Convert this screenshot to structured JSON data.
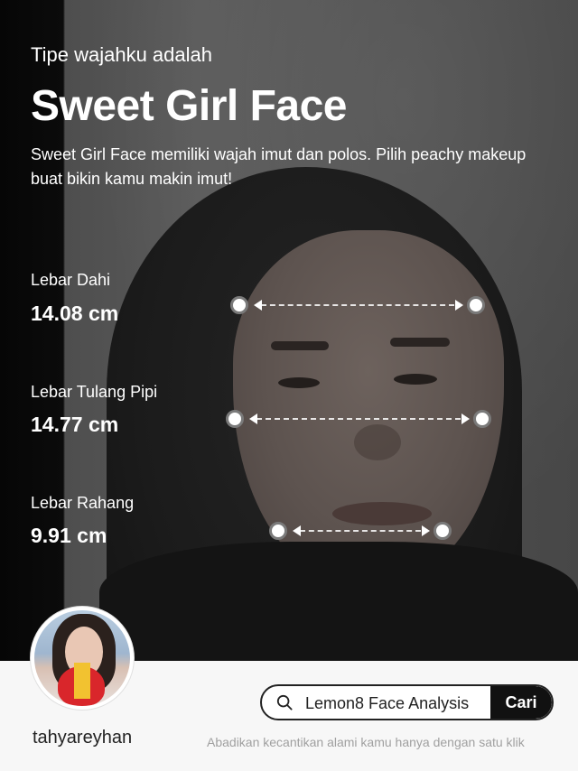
{
  "header": {
    "intro": "Tipe wajahku adalah",
    "face_type": "Sweet Girl Face",
    "description": "Sweet Girl Face memiliki wajah imut dan polos. Pilih peachy makeup buat bikin kamu makin imut!"
  },
  "measurements": [
    {
      "label": "Lebar Dahi",
      "value": "14.08 cm"
    },
    {
      "label": "Lebar Tulang Pipi",
      "value": "14.77 cm"
    },
    {
      "label": "Lebar Rahang",
      "value": "9.91 cm"
    }
  ],
  "profile": {
    "username": "tahyareyhan"
  },
  "search": {
    "query": "Lemon8 Face Analysis",
    "button_label": "Cari",
    "icon": "search-icon"
  },
  "footer": {
    "tagline": "Abadikan kecantikan alami kamu hanya dengan satu klik"
  }
}
